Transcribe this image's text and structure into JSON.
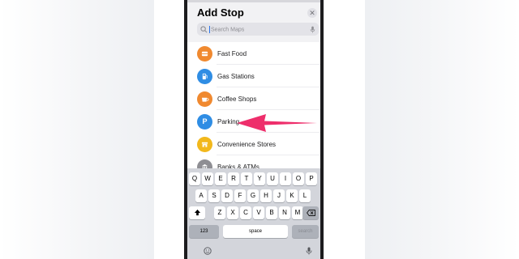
{
  "sheet": {
    "title": "Add Stop",
    "close_icon": "xmark-circle-icon"
  },
  "search": {
    "placeholder": "Search Maps",
    "icons": [
      "search-icon",
      "mic-icon"
    ]
  },
  "categories": [
    {
      "label": "Fast Food",
      "icon": "fast-food-icon",
      "color": "#f0892f"
    },
    {
      "label": "Gas Stations",
      "icon": "gas-pump-icon",
      "color": "#2f8de4"
    },
    {
      "label": "Coffee Shops",
      "icon": "coffee-cup-icon",
      "color": "#f0892f"
    },
    {
      "label": "Parking",
      "icon": "parking-icon",
      "glyph": "P",
      "color": "#2f8de4"
    },
    {
      "label": "Convenience Stores",
      "icon": "store-icon",
      "color": "#f2b81c"
    },
    {
      "label": "Banks & ATMs",
      "icon": "bank-icon",
      "color": "#8e8e93"
    }
  ],
  "annotation": {
    "icon": "pink-arrow-icon",
    "color": "#ee2e6b"
  },
  "keyboard": {
    "row1": [
      "Q",
      "W",
      "E",
      "R",
      "T",
      "Y",
      "U",
      "I",
      "O",
      "P"
    ],
    "row2": [
      "A",
      "S",
      "D",
      "F",
      "G",
      "H",
      "J",
      "K",
      "L"
    ],
    "row3": [
      "Z",
      "X",
      "C",
      "V",
      "B",
      "N",
      "M"
    ],
    "shift_icon": "shift-icon",
    "delete_icon": "delete-backspace-icon",
    "numbers_label": "123",
    "space_label": "space",
    "search_label": "search",
    "emoji_icon": "emoji-icon",
    "dictation_icon": "mic-icon"
  }
}
